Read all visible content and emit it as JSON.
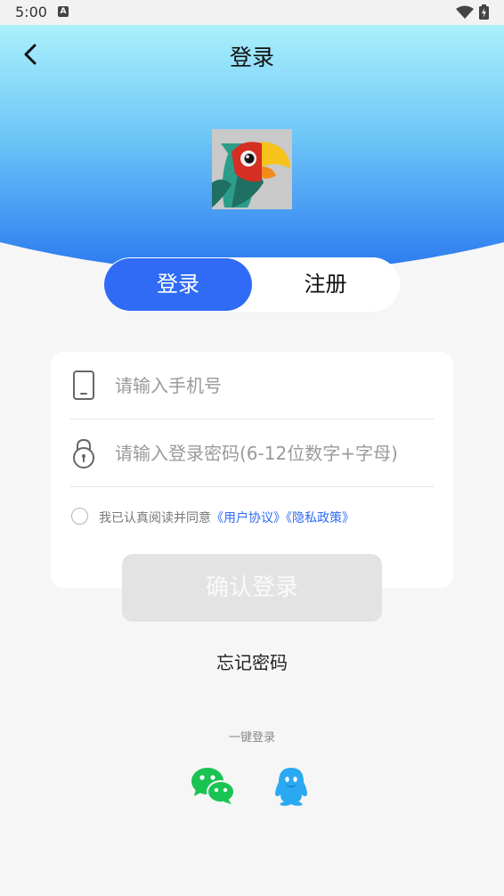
{
  "status_bar": {
    "time": "5:00",
    "notification_icon": "a-badge-icon",
    "wifi_icon": "wifi-icon",
    "battery_icon": "battery-charging-icon"
  },
  "header": {
    "title": "登录",
    "back_icon": "chevron-left-icon",
    "gradient_top": "#b7fafc",
    "gradient_bottom": "#2f7df0"
  },
  "logo": {
    "icon": "parrot-logo-icon"
  },
  "tabs": {
    "login_label": "登录",
    "register_label": "注册",
    "active": "login",
    "active_color": "#2f6bf5"
  },
  "form": {
    "phone": {
      "placeholder": "请输入手机号",
      "value": "",
      "icon": "phone-icon"
    },
    "password": {
      "placeholder": "请输入登录密码(6-12位数字+字母)",
      "value": "",
      "icon": "lock-icon"
    },
    "agreement": {
      "checked": false,
      "prefix": "我已认真阅读并同意",
      "user_agreement": "《用户协议》",
      "privacy_policy": "《隐私政策》"
    }
  },
  "confirm_button": {
    "label": "确认登录",
    "enabled": false
  },
  "forgot_password": "忘记密码",
  "quick_login": {
    "label": "一键登录",
    "providers": [
      {
        "name": "wechat",
        "icon": "wechat-icon",
        "color": "#19c452"
      },
      {
        "name": "qq",
        "icon": "qq-icon",
        "color": "#2aa8f2"
      }
    ]
  }
}
